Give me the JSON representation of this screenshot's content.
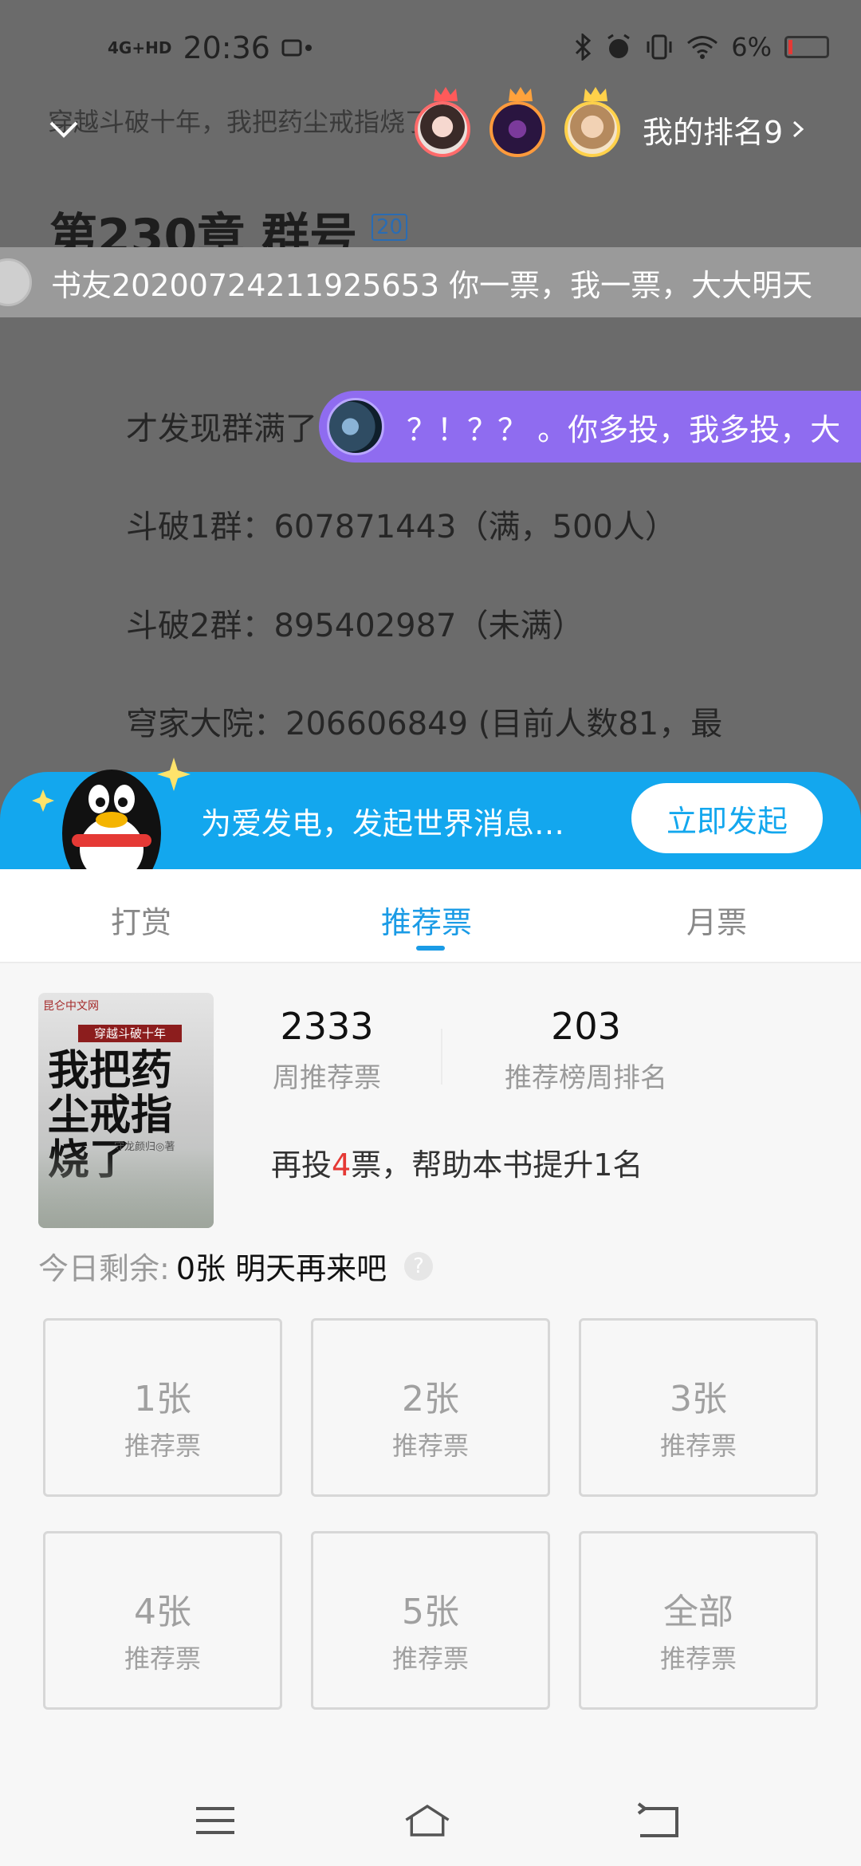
{
  "status": {
    "signal": "4G+HD",
    "time": "20:36",
    "battery": "6%"
  },
  "reader": {
    "book_title_line": "穿越斗破十年，我把药尘戒指烧了",
    "my_rank": "我的排名9",
    "chapter_title": "第230章 群号",
    "chapter_badge": "20",
    "danmu_1": "书友20200724211925653 你一票，我一票，大大明天",
    "danmu_2": "？！？？ 。你多投，我多投，大",
    "paragraphs": [
      "才发现群满了",
      "斗破1群：607871443（满，500人）",
      "斗破2群：895402987（未满）",
      "穹家大院：206606849 (目前人数81，最"
    ]
  },
  "promo": {
    "text": "为爱发电，发起世界消息…",
    "button": "立即发起"
  },
  "tabs": {
    "items": [
      "打赏",
      "推荐票",
      "月票"
    ],
    "active": 1
  },
  "book": {
    "cover_publisher": "昆仑中文网",
    "cover_banner": "穿越斗破十年",
    "cover_title": "我把药尘戒指烧了",
    "cover_author": "守龙颜归◎著"
  },
  "stats": {
    "weekly_votes": "2333",
    "weekly_votes_label": "周推荐票",
    "weekly_rank": "203",
    "weekly_rank_label": "推荐榜周排名"
  },
  "tip": {
    "prefix": "再投",
    "count": "4",
    "suffix": "票，帮助本书提升1名"
  },
  "remaining": {
    "label": "今日剩余:",
    "value": "0张 明天再来吧",
    "help": "?"
  },
  "options": [
    {
      "num": "1张",
      "label": "推荐票"
    },
    {
      "num": "2张",
      "label": "推荐票"
    },
    {
      "num": "3张",
      "label": "推荐票"
    },
    {
      "num": "4张",
      "label": "推荐票"
    },
    {
      "num": "5张",
      "label": "推荐票"
    },
    {
      "num": "全部",
      "label": "推荐票"
    }
  ],
  "nav": {
    "icons": [
      "menu-icon",
      "home-icon",
      "back-icon"
    ]
  }
}
